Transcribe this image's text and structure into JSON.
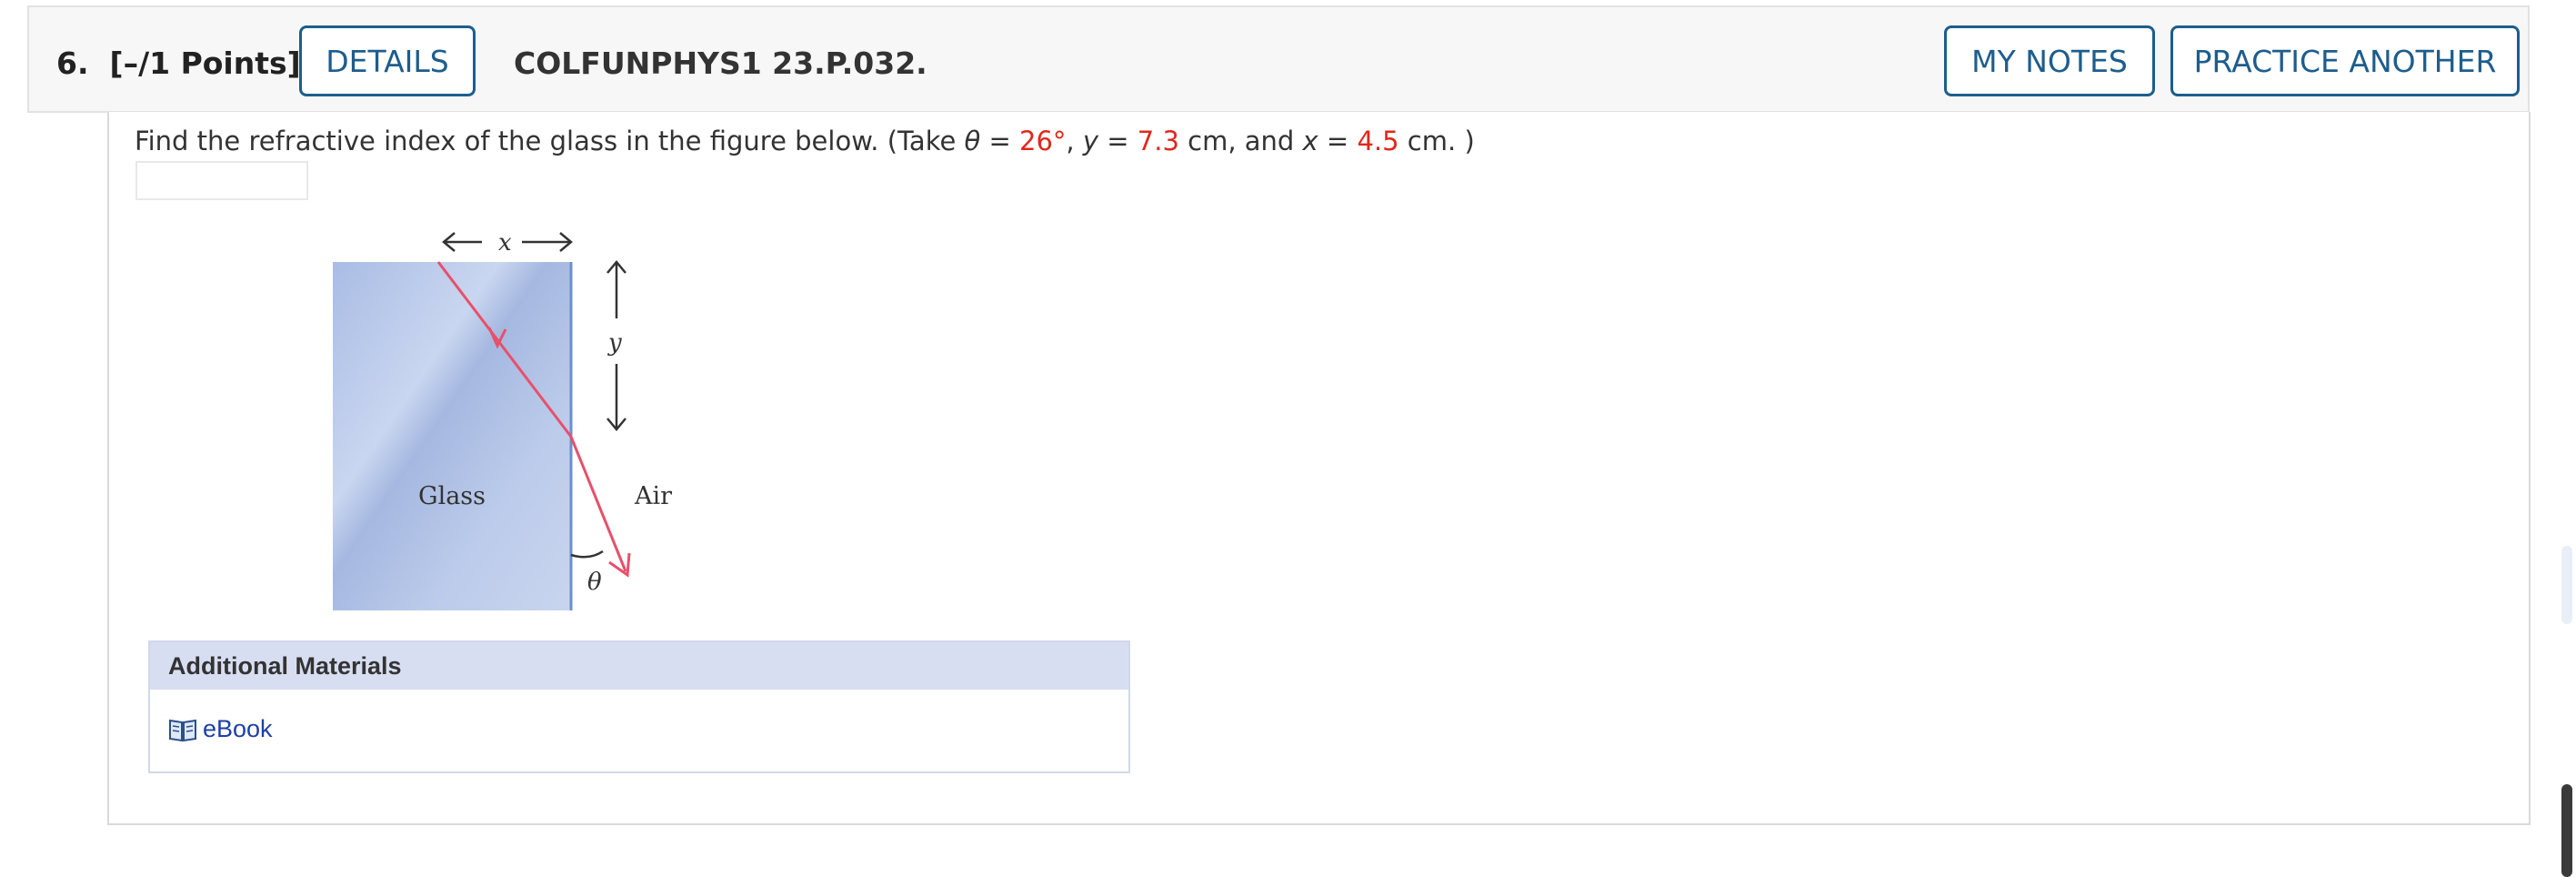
{
  "header": {
    "question_number": "6.",
    "points": "[–/1 Points]",
    "details_label": "DETAILS",
    "course_code": "COLFUNPHYS1 23.P.032.",
    "my_notes_label": "MY NOTES",
    "practice_label": "PRACTICE ANOTHER"
  },
  "question": {
    "prefix": "Find the refractive index of the glass in the figure below.  (Take ",
    "theta_symbol": "θ",
    "eq1": " = ",
    "theta_value": "26°",
    "sep1": ", ",
    "y_symbol": "y",
    "eq2": " = ",
    "y_value": "7.3",
    "unit1": " cm, and ",
    "x_symbol": "x",
    "eq3": " = ",
    "x_value": "4.5",
    "unit2": " cm. )"
  },
  "answer": {
    "value": ""
  },
  "figure": {
    "x_label": "x",
    "y_label": "y",
    "glass_label": "Glass",
    "air_label": "Air",
    "theta_label": "θ",
    "colors": {
      "glass": "#b8c7e8",
      "ray": "#e8506a",
      "interface": "#6a8fd0"
    }
  },
  "materials": {
    "title": "Additional Materials",
    "ebook_label": "eBook",
    "ebook_icon": "book-icon"
  },
  "colors": {
    "accent": "#1e5d8c",
    "highlight": "#e0271d",
    "link": "#1f3fa8"
  }
}
